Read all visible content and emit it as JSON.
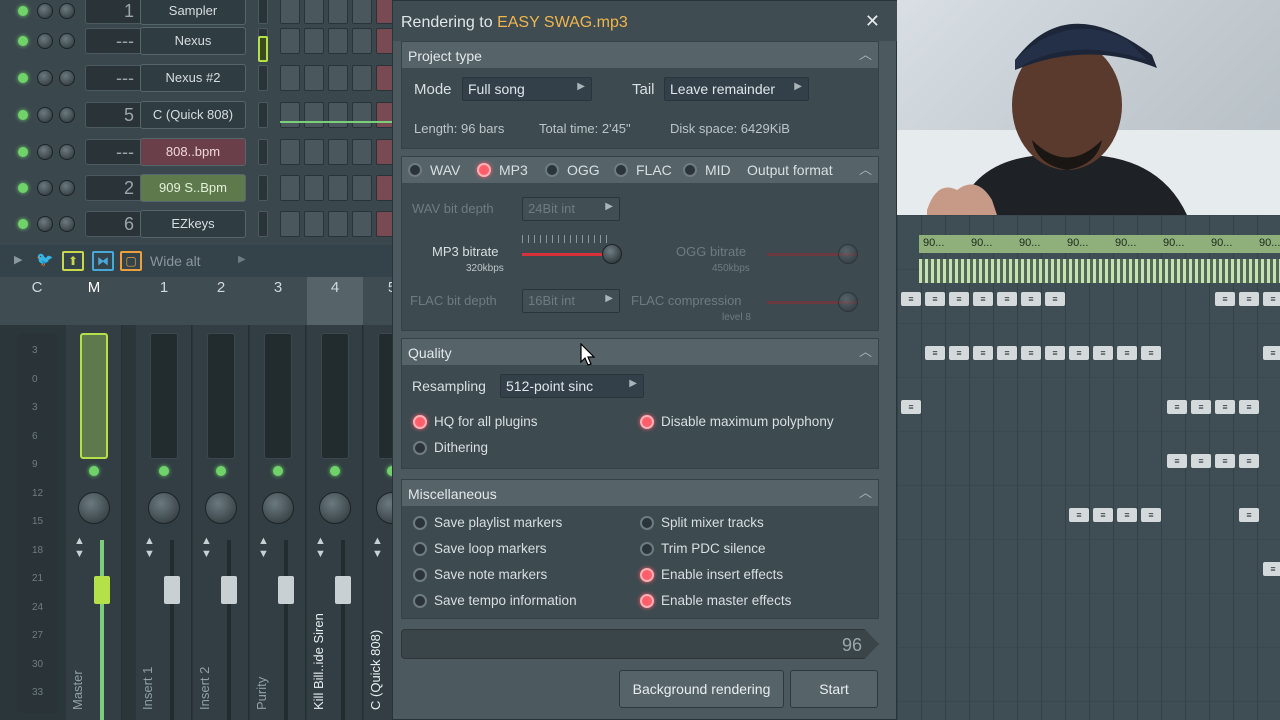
{
  "rack": {
    "channels": [
      {
        "num": "1",
        "name": "Sampler",
        "style": "plain"
      },
      {
        "num": "---",
        "name": "Nexus",
        "style": "plain"
      },
      {
        "num": "---",
        "name": "Nexus #2",
        "style": "plain"
      },
      {
        "num": "5",
        "name": "C (Quick 808)",
        "style": "plain"
      },
      {
        "num": "---",
        "name": "808..bpm",
        "style": "red"
      },
      {
        "num": "2",
        "name": "909 S..Bpm",
        "style": "grn"
      },
      {
        "num": "6",
        "name": "EZkeys",
        "style": "plain"
      }
    ]
  },
  "mixer": {
    "preset_label": "Wide alt",
    "headers": [
      "C",
      "M",
      "1",
      "2",
      "3",
      "4",
      "5"
    ],
    "db_scale": [
      "3",
      "0",
      "3",
      "6",
      "9",
      "12",
      "15",
      "18",
      "21",
      "24",
      "27",
      "30",
      "33"
    ],
    "strip_names": [
      "Master",
      "Insert 1",
      "Insert 2",
      "Purity",
      "Kill Bill..ide Siren",
      "C (Quick 808)"
    ]
  },
  "dialog": {
    "title_prefix": "Rendering to ",
    "filename": "EASY SWAG.mp3",
    "close_glyph": "✕",
    "project_type": {
      "header": "Project type",
      "mode_label": "Mode",
      "mode_value": "Full song",
      "tail_label": "Tail",
      "tail_value": "Leave remainder",
      "length": "Length: 96 bars",
      "total_time": "Total time: 2'45\"",
      "disk_space": "Disk space: 6429KiB"
    },
    "output_format": {
      "formats": [
        "WAV",
        "MP3",
        "OGG",
        "FLAC",
        "MID"
      ],
      "selected": "MP3",
      "label": "Output format",
      "wav_bit_label": "WAV bit depth",
      "wav_bit_value": "24Bit int",
      "mp3_label": "MP3 bitrate",
      "mp3_sub": "320kbps",
      "mp3_level": 1.0,
      "ogg_label": "OGG bitrate",
      "ogg_sub": "450kbps",
      "flac_bit_label": "FLAC bit depth",
      "flac_bit_value": "16Bit int",
      "flac_comp_label": "FLAC compression",
      "flac_comp_sub": "level 8"
    },
    "quality": {
      "header": "Quality",
      "resampling_label": "Resampling",
      "resampling_value": "512-point sinc",
      "hq_label": "HQ for all plugins",
      "hq_on": true,
      "dither_label": "Dithering",
      "dither_on": false,
      "poly_label": "Disable maximum polyphony",
      "poly_on": true
    },
    "misc": {
      "header": "Miscellaneous",
      "left": [
        {
          "label": "Save playlist markers",
          "on": false
        },
        {
          "label": "Save loop markers",
          "on": false
        },
        {
          "label": "Save note markers",
          "on": false
        },
        {
          "label": "Save tempo information",
          "on": false
        }
      ],
      "right": [
        {
          "label": "Split mixer tracks",
          "on": false
        },
        {
          "label": "Trim PDC silence",
          "on": false
        },
        {
          "label": "Enable insert effects",
          "on": true
        },
        {
          "label": "Enable master effects",
          "on": true
        }
      ]
    },
    "progress_value": "96",
    "background_btn": "Background rendering",
    "start_btn": "Start"
  },
  "playlist": {
    "clip_label": "90..."
  },
  "colors": {
    "accent_orange": "#f0b64c",
    "radio_on": "#ff5e6a",
    "slider_red": "#d7313c",
    "led_green": "#6fd36a"
  }
}
